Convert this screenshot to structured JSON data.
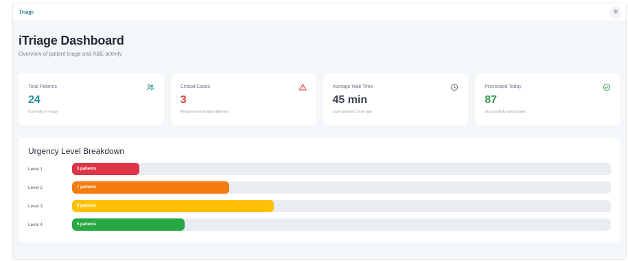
{
  "topbar": {
    "brand": "Triage",
    "settings_icon": "settings-icon"
  },
  "header": {
    "title": "iTriage Dashboard",
    "subtitle": "Overview of patient triage and A&E activity"
  },
  "cards": [
    {
      "label": "Total Patients",
      "value": "24",
      "sub": "Currently in triage",
      "icon": "users-icon",
      "color": "#2a8ca0"
    },
    {
      "label": "Critical Cases",
      "value": "3",
      "sub": "Requires immediate attention",
      "icon": "alert-triangle-icon",
      "color": "#d63b3b"
    },
    {
      "label": "Average Wait Time",
      "value": "45 min",
      "sub": "Last updated 5 min ago",
      "icon": "clock-icon",
      "color": "#3a4552"
    },
    {
      "label": "Processed Today",
      "value": "87",
      "sub": "Successfully discharged",
      "icon": "check-circle-icon",
      "color": "#2f9e4f"
    }
  ],
  "breakdown": {
    "title": "Urgency Level Breakdown",
    "levels": [
      {
        "label": "Level 1",
        "bar_text": "3 patients",
        "count": 3,
        "color": "#dc3545"
      },
      {
        "label": "Level 2",
        "bar_text": "7 patients",
        "count": 7,
        "color": "#f57c10"
      },
      {
        "label": "Level 3",
        "bar_text": "9 patients",
        "count": 9,
        "color": "#ffc107"
      },
      {
        "label": "Level 4",
        "bar_text": "5 patients",
        "count": 5,
        "color": "#28a745"
      }
    ],
    "total": 24
  }
}
